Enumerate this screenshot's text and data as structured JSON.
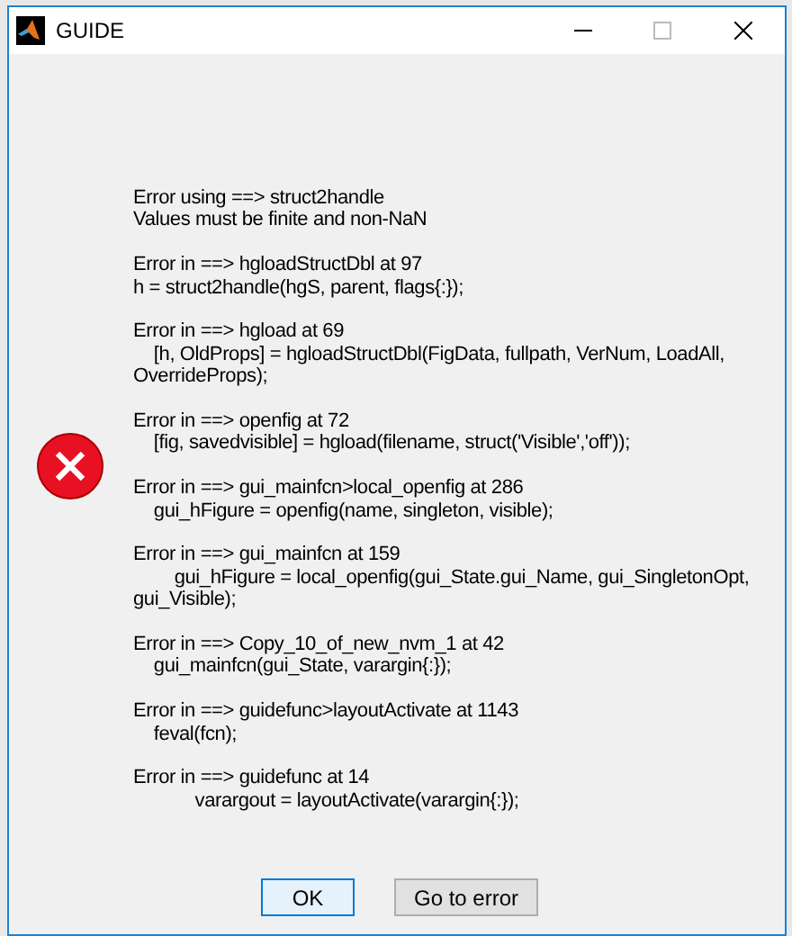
{
  "window": {
    "title": "GUIDE"
  },
  "message": [
    [
      "Error using ==> struct2handle",
      "Values must be finite and non-NaN"
    ],
    [
      "Error in ==> hgloadStructDbl at 97",
      "h = struct2handle(hgS, parent, flags{:});"
    ],
    [
      "Error in ==> hgload at 69",
      "    [h, OldProps] = hgloadStructDbl(FigData, fullpath, VerNum, LoadAll,",
      "OverrideProps);"
    ],
    [
      "Error in ==> openfig at 72",
      "    [fig, savedvisible] = hgload(filename, struct('Visible','off'));"
    ],
    [
      "Error in ==> gui_mainfcn>local_openfig at 286",
      "    gui_hFigure = openfig(name, singleton, visible);"
    ],
    [
      "Error in ==> gui_mainfcn at 159",
      "        gui_hFigure = local_openfig(gui_State.gui_Name, gui_SingletonOpt,",
      "gui_Visible);"
    ],
    [
      "Error in ==> Copy_10_of_new_nvm_1 at 42",
      "    gui_mainfcn(gui_State, varargin{:});"
    ],
    [
      "Error in ==> guidefunc>layoutActivate at 1143",
      "    feval(fcn);"
    ],
    [
      "Error in ==> guidefunc at 14",
      "            varargout = layoutActivate(varargin{:});"
    ]
  ],
  "buttons": [
    {
      "label": "OK",
      "selected": true
    },
    {
      "label": "Go to error",
      "selected": false
    }
  ]
}
